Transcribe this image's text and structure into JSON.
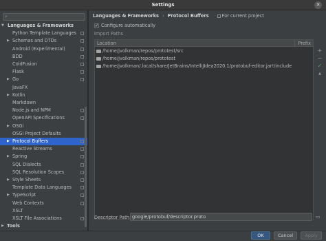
{
  "window": {
    "title": "Settings",
    "close_glyph": "✕"
  },
  "search": {
    "icon": "search-icon",
    "placeholder": ""
  },
  "sidebar": {
    "items": [
      {
        "label": "Languages & Frameworks",
        "expanded": true,
        "bold": true
      },
      {
        "label": "Python Template Languages",
        "project": true
      },
      {
        "label": "Schemas and DTDs",
        "arrow": true,
        "project": true
      },
      {
        "label": "Android (Experimental)",
        "project": true
      },
      {
        "label": "BDD",
        "project": true
      },
      {
        "label": "ColdFusion",
        "project": true
      },
      {
        "label": "Flask",
        "project": true
      },
      {
        "label": "Go",
        "arrow": true,
        "project": true
      },
      {
        "label": "JavaFX"
      },
      {
        "label": "Kotlin",
        "arrow": true
      },
      {
        "label": "Markdown"
      },
      {
        "label": "Node.js and NPM",
        "project": true
      },
      {
        "label": "OpenAPI Specifications",
        "project": true
      },
      {
        "label": "OSGi",
        "arrow": true
      },
      {
        "label": "OSGi Project Defaults"
      },
      {
        "label": "Protocol Buffers",
        "arrow": true,
        "project": true,
        "selected": true
      },
      {
        "label": "Reactive Streams",
        "project": true
      },
      {
        "label": "Spring",
        "arrow": true,
        "project": true
      },
      {
        "label": "SQL Dialects",
        "project": true
      },
      {
        "label": "SQL Resolution Scopes",
        "project": true
      },
      {
        "label": "Style Sheets",
        "arrow": true,
        "project": true
      },
      {
        "label": "Template Data Languages",
        "project": true
      },
      {
        "label": "TypeScript",
        "arrow": true,
        "project": true
      },
      {
        "label": "Web Contexts",
        "project": true
      },
      {
        "label": "XSLT"
      },
      {
        "label": "XSLT File Associations",
        "project": true
      },
      {
        "label": "Tools",
        "arrow": true,
        "bold": true
      }
    ]
  },
  "main": {
    "breadcrumb": {
      "parent": "Languages & Frameworks",
      "sep": "›",
      "current": "Protocol Buffers",
      "scope": "For current project"
    },
    "configure_auto": {
      "label": "Configure automatically",
      "checked": true,
      "check_glyph": "✓"
    },
    "import_paths": {
      "section_label": "Import Paths",
      "columns": [
        "Location",
        "Prefix"
      ],
      "rows": [
        "/home/jvolkman/repos/prototest/src",
        "/home/jvolkman/repos/prototest",
        "/home/jvolkman/.local/share/JetBrains/IntelliJIdea2020.1/protobuf-editor.jar!/include"
      ]
    },
    "toolbar": {
      "add": "+",
      "remove": "−",
      "up": "▲",
      "down": "▼",
      "check": "✓"
    },
    "descriptor": {
      "label": "Descriptor Path:",
      "value": "google/protobuf/descriptor.proto",
      "browse": "▭"
    }
  },
  "footer": {
    "ok": "OK",
    "cancel": "Cancel",
    "apply": "Apply"
  }
}
